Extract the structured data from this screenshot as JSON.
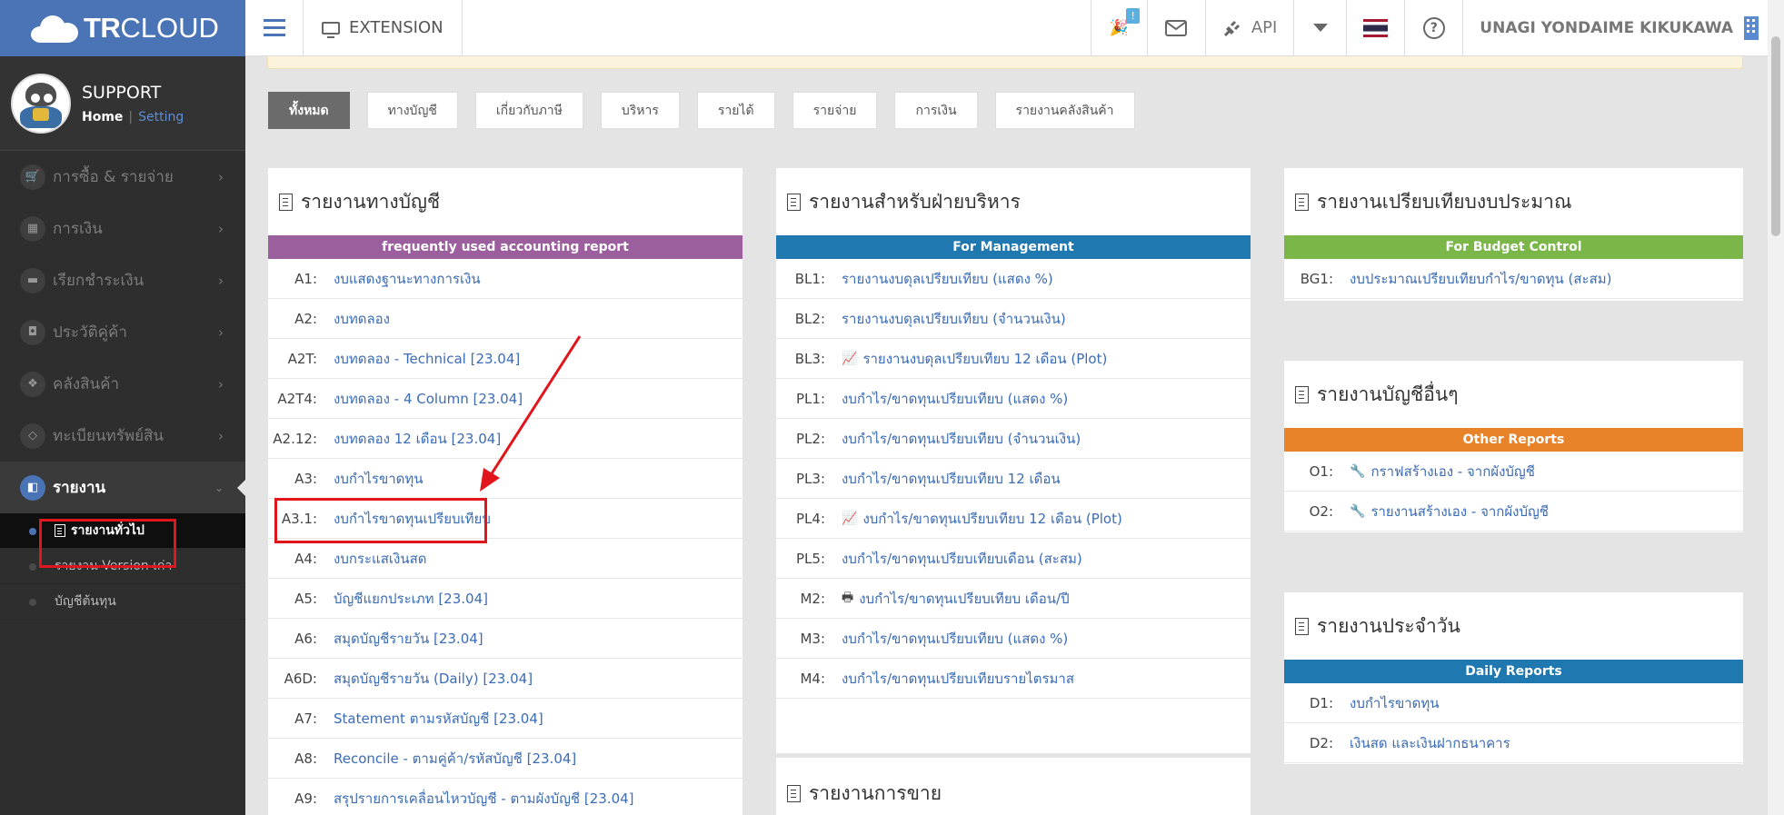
{
  "brand": {
    "logo_strong": "TR",
    "logo_light": "CLOUD"
  },
  "profile": {
    "name": "SUPPORT",
    "home": "Home",
    "separator": "|",
    "setting": "Setting"
  },
  "sidebar": {
    "items": [
      {
        "label": "การซื้อ & รายจ่าย",
        "icon": "cart-icon"
      },
      {
        "label": "การเงิน",
        "icon": "calendar-icon"
      },
      {
        "label": "เรียกชำระเงิน",
        "icon": "card-icon"
      },
      {
        "label": "ประวัติคู่ค้า",
        "icon": "contact-icon"
      },
      {
        "label": "คลังสินค้า",
        "icon": "boxes-icon"
      },
      {
        "label": "ทะเบียนทรัพย์สิน",
        "icon": "diamond-icon"
      },
      {
        "label": "รายงาน",
        "icon": "report-icon",
        "active": true
      }
    ],
    "sub_items": [
      {
        "label": "รายงานทั่วไป",
        "active": true
      },
      {
        "label": "รายงาน Version เก่า"
      },
      {
        "label": "บัญชีต้นทุน"
      }
    ]
  },
  "topbar": {
    "extension_label": "EXTENSION",
    "notification_count": "!",
    "api_label": "API",
    "user_name": "UNAGI YONDAIME KIKUKAWA"
  },
  "filters": [
    "ทั้งหมด",
    "ทางบัญชี",
    "เกี่ยวกับภาษี",
    "บริหาร",
    "รายได้",
    "รายจ่าย",
    "การเงิน",
    "รายงานคลังสินค้า"
  ],
  "panels": {
    "accounting": {
      "title": "รายงานทางบัญชี",
      "band": "frequently used accounting report",
      "band_color": "#9b5f9e",
      "rows": [
        {
          "code": "A1:",
          "label": "งบแสดงฐานะทางการเงิน"
        },
        {
          "code": "A2:",
          "label": "งบทดลอง"
        },
        {
          "code": "A2T:",
          "label": "งบทดลอง - Technical [23.04]"
        },
        {
          "code": "A2T4:",
          "label": "งบทดลอง - 4 Column [23.04]"
        },
        {
          "code": "A2.12:",
          "label": "งบทดลอง 12 เดือน [23.04]"
        },
        {
          "code": "A3:",
          "label": "งบกำไรขาดทุน"
        },
        {
          "code": "A3.1:",
          "label": "งบกำไรขาดทุนเปรียบเทียบ"
        },
        {
          "code": "A4:",
          "label": "งบกระแสเงินสด"
        },
        {
          "code": "A5:",
          "label": "บัญชีแยกประเภท [23.04]"
        },
        {
          "code": "A6:",
          "label": "สมุดบัญชีรายวัน [23.04]"
        },
        {
          "code": "A6D:",
          "label": "สมุดบัญชีรายวัน (Daily) [23.04]"
        },
        {
          "code": "A7:",
          "label": "Statement ตามรหัสบัญชี [23.04]"
        },
        {
          "code": "A8:",
          "label": "Reconcile - ตามคู่ค้า/รหัสบัญชี [23.04]"
        },
        {
          "code": "A9:",
          "label": "สรุปรายการเคลื่อนไหวบัญชี - ตามผังบัญชี [23.04]"
        }
      ]
    },
    "management": {
      "title": "รายงานสำหรับฝ่ายบริหาร",
      "band": "For Management",
      "band_color": "#1f78b0",
      "rows": [
        {
          "code": "BL1:",
          "label": "รายงานงบดุลเปรียบเทียบ (แสดง %)"
        },
        {
          "code": "BL2:",
          "label": "รายงานงบดุลเปรียบเทียบ (จำนวนเงิน)"
        },
        {
          "code": "BL3:",
          "label": "รายงานงบดุลเปรียบเทียบ 12 เดือน (Plot)",
          "icon": "line-chart-icon"
        },
        {
          "code": "PL1:",
          "label": "งบกำไร/ขาดทุนเปรียบเทียบ (แสดง %)"
        },
        {
          "code": "PL2:",
          "label": "งบกำไร/ขาดทุนเปรียบเทียบ (จำนวนเงิน)"
        },
        {
          "code": "PL3:",
          "label": "งบกำไร/ขาดทุนเปรียบเทียบ 12 เดือน"
        },
        {
          "code": "PL4:",
          "label": "งบกำไร/ขาดทุนเปรียบเทียบ 12 เดือน (Plot)",
          "icon": "line-chart-icon"
        },
        {
          "code": "PL5:",
          "label": "งบกำไร/ขาดทุนเปรียบเทียบเดือน (สะสม)"
        },
        {
          "code": "M2:",
          "label": "งบกำไร/ขาดทุนเปรียบเทียบ เดือน/ปี",
          "icon": "printer-icon"
        },
        {
          "code": "M3:",
          "label": "งบกำไร/ขาดทุนเปรียบเทียบ (แสดง %)"
        },
        {
          "code": "M4:",
          "label": "งบกำไร/ขาดทุนเปรียบเทียบรายไตรมาส"
        }
      ]
    },
    "sales": {
      "title": "รายงานการขาย"
    },
    "budget": {
      "title": "รายงานเปรียบเทียบงบประมาณ",
      "band": "For Budget Control",
      "band_color": "#7ab648",
      "rows": [
        {
          "code": "BG1:",
          "label": "งบประมาณเปรียบเทียบกำไร/ขาดทุน (สะสม)"
        }
      ]
    },
    "other": {
      "title": "รายงานบัญชีอื่นๆ",
      "band": "Other Reports",
      "band_color": "#e8832a",
      "rows": [
        {
          "code": "O1:",
          "label": "กราฟสร้างเอง - จากผังบัญชี",
          "icon": "wrench-icon"
        },
        {
          "code": "O2:",
          "label": "รายงานสร้างเอง - จากผังบัญชี",
          "icon": "wrench-icon"
        }
      ]
    },
    "daily": {
      "title": "รายงานประจำวัน",
      "band": "Daily Reports",
      "band_color": "#1f78b0",
      "rows": [
        {
          "code": "D1:",
          "label": "งบกำไรขาดทุน"
        },
        {
          "code": "D2:",
          "label": "เงินสด และเงินฝากธนาคาร"
        }
      ]
    }
  },
  "colors": {
    "accent": "#4a74b6",
    "link": "#3b6cb5",
    "annotation": "#e0161c"
  }
}
